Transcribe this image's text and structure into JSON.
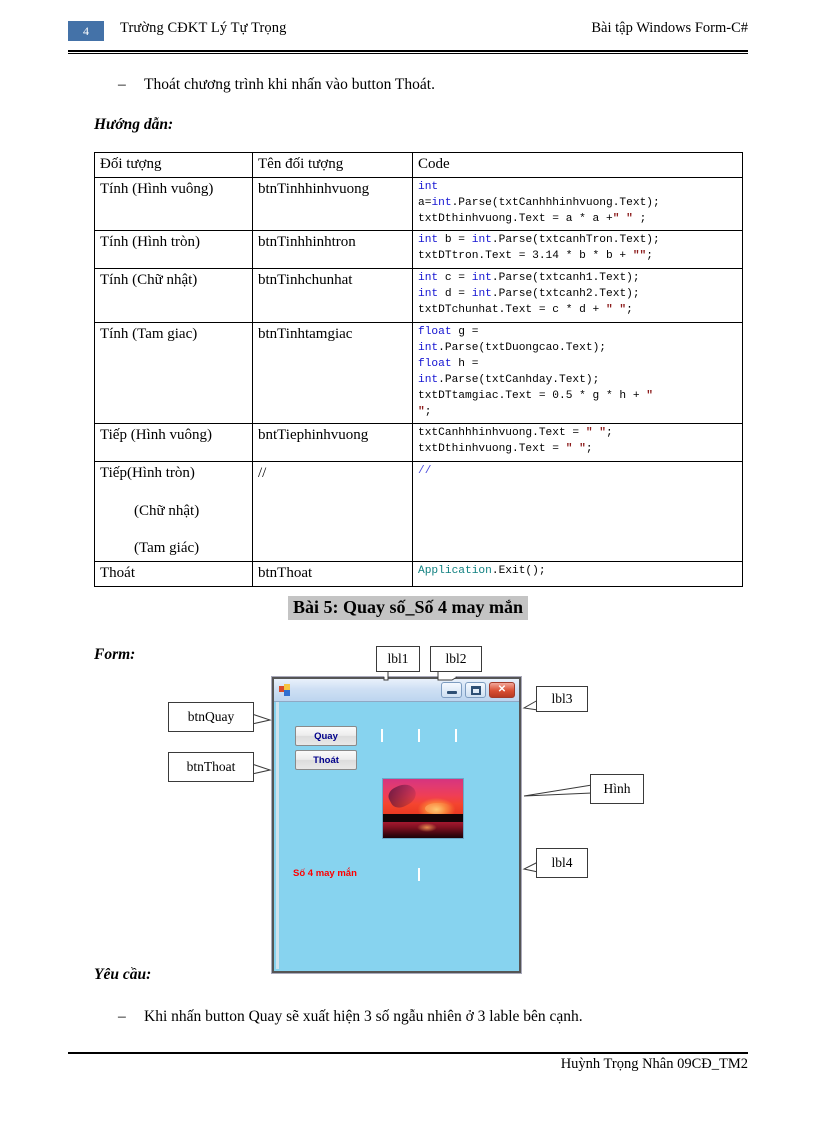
{
  "header": {
    "page_number": "4",
    "left_text": "Trường CĐKT Lý Tự Trọng",
    "right_text": "Bài tập Windows Form-C#"
  },
  "intro": {
    "bullet_1": "Thoát chương trình khi nhấn vào button Thoát.",
    "huong_dan_label": "Hướng dẫn:"
  },
  "table": {
    "headers": {
      "col1": "Đối tượng",
      "col2": "Tên đối tượng",
      "col3": "Code"
    },
    "rows": [
      {
        "object": "Tính (Hình vuông)",
        "name": "btnTinhhinhvuong",
        "code_plain": "int a=int.Parse(txtCanhhhinhvuong.Text);\ntxtDthinhvuong.Text = a * a +\" \" ;"
      },
      {
        "object": "Tính (Hình tròn)",
        "name": "btnTinhhinhtron",
        "code_plain": "int b = int.Parse(txtcanhTron.Text);\ntxtDTtron.Text = 3.14 * b * b + \"\";"
      },
      {
        "object": "Tính (Chữ nhật)",
        "name": "btnTinhchunhat",
        "code_plain": "int c = int.Parse(txtcanh1.Text);\nint d = int.Parse(txtcanh2.Text);\ntxtDTchunhat.Text = c * d + \" \";"
      },
      {
        "object": "Tính (Tam giac)",
        "name": "btnTinhtamgiac",
        "code_plain": "float g =\nint.Parse(txtDuongcao.Text);\nfloat h =\nint.Parse(txtCanhday.Text);\ntxtDTtamgiac.Text = 0.5 * g * h + \" \";"
      },
      {
        "object": "Tiếp (Hình vuông)",
        "name": "bntTiephinhvuong",
        "code_plain": "txtCanhhhinhvuong.Text = \" \";\ntxtDthinhvuong.Text = \" \";"
      },
      {
        "object": "Tiếp(Hình tròn)",
        "object_line2": "(Chữ nhật)",
        "object_line3": "(Tam giác)",
        "name": "//",
        "code_plain": "//"
      },
      {
        "object": "Thoát",
        "name": "btnThoat",
        "code_plain": "Application.Exit();"
      }
    ]
  },
  "bai5": {
    "title": "Bài 5: Quay số_Số 4 may mắn",
    "form_label": "Form:",
    "yeu_cau_label": "Yêu cầu:",
    "yeu_cau_bullet": "Khi nhấn button Quay sẽ xuất hiện 3 số ngẫu nhiên ở 3 lable bên cạnh."
  },
  "mockup": {
    "window": {
      "title": "",
      "minimize_glyph": "–",
      "maximize_glyph": "□",
      "close_glyph": "✕"
    },
    "buttons": [
      {
        "id": "btn-quay",
        "label": "Quay"
      },
      {
        "id": "btn-thoat",
        "label": "Thoát"
      }
    ],
    "lucky_label": "Số 4 may mắn",
    "callouts": [
      {
        "id": "lbl1",
        "text": "lbl1"
      },
      {
        "id": "lbl2",
        "text": "lbl2"
      },
      {
        "id": "lbl3",
        "text": "lbl3"
      },
      {
        "id": "lbl4",
        "text": "lbl4"
      },
      {
        "id": "hinh",
        "text": "Hình"
      },
      {
        "id": "btnQuay",
        "text": "btnQuay"
      },
      {
        "id": "btnThoat",
        "text": "btnThoat"
      }
    ],
    "colors": {
      "form_background": "#87d3ef",
      "button_text": "#00008b",
      "lucky_text": "#ff0000",
      "titlebar": "#cfe0f4"
    }
  },
  "footer": {
    "text": "Huỳnh Trọng Nhân 09CĐ_TM2"
  }
}
